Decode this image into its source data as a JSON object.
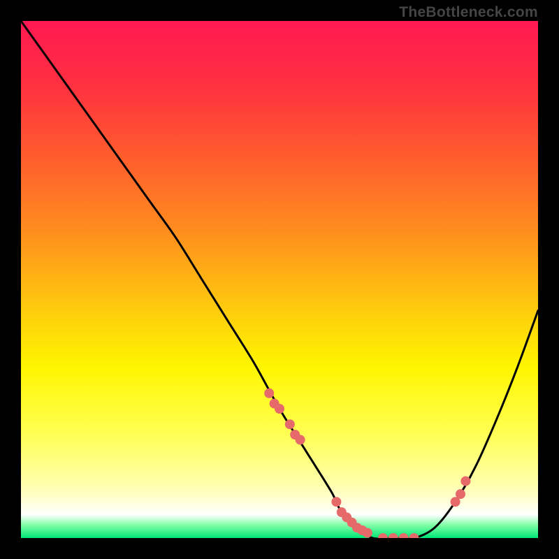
{
  "watermark": "TheBottleneck.com",
  "gradient": {
    "stops": [
      {
        "offset": 0.0,
        "color": "#ff1952"
      },
      {
        "offset": 0.12,
        "color": "#ff2f41"
      },
      {
        "offset": 0.25,
        "color": "#ff582f"
      },
      {
        "offset": 0.4,
        "color": "#ff8b1f"
      },
      {
        "offset": 0.55,
        "color": "#ffc80e"
      },
      {
        "offset": 0.67,
        "color": "#fff600"
      },
      {
        "offset": 0.8,
        "color": "#ffff55"
      },
      {
        "offset": 0.9,
        "color": "#ffffb0"
      },
      {
        "offset": 0.955,
        "color": "#ffffff"
      },
      {
        "offset": 0.975,
        "color": "#7fffa5"
      },
      {
        "offset": 1.0,
        "color": "#00e676"
      }
    ]
  },
  "chart_data": {
    "type": "line",
    "title": "",
    "xlabel": "",
    "ylabel": "",
    "xlim": [
      0,
      100
    ],
    "ylim": [
      0,
      100
    ],
    "x": [
      0,
      5,
      10,
      15,
      20,
      25,
      30,
      35,
      40,
      45,
      50,
      55,
      60,
      62,
      65,
      68,
      72,
      76,
      80,
      84,
      88,
      92,
      96,
      100
    ],
    "values": [
      100,
      93,
      86,
      79,
      72,
      65,
      58,
      50,
      42,
      34,
      25,
      17,
      9,
      5,
      2,
      0,
      0,
      0,
      2,
      7,
      14,
      23,
      33,
      44
    ],
    "markers": {
      "x": [
        48,
        49,
        50,
        52,
        53,
        54,
        61,
        62,
        63,
        64,
        65,
        66,
        67,
        70,
        72,
        74,
        76,
        84,
        85,
        86
      ],
      "y": [
        28,
        26,
        25,
        22,
        20,
        19,
        7,
        5,
        4,
        3,
        2,
        1.5,
        1,
        0,
        0,
        0,
        0,
        7,
        8.5,
        11
      ],
      "color": "#e76a6a",
      "radius": 7
    }
  }
}
